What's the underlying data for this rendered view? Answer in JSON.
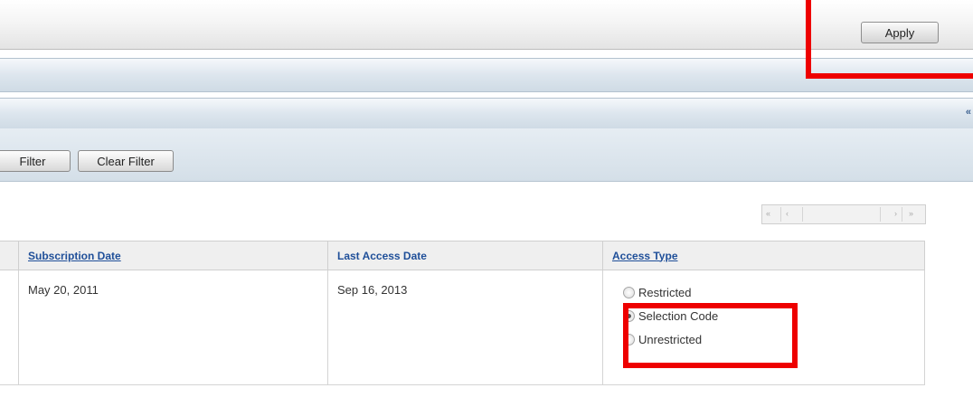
{
  "toolbar": {
    "apply_label": "Apply"
  },
  "panels": {
    "first": {
      "toggle_icon": "expand-double-chevron-icon",
      "toggle_glyph": "»"
    },
    "second": {
      "toggle_icon": "collapse-double-chevron-icon",
      "toggle_glyph": "«"
    }
  },
  "filter_bar": {
    "filter_label": "Filter",
    "clear_filter_label": "Clear Filter"
  },
  "pager": {
    "first": "«",
    "prev": "‹",
    "next": "›",
    "last": "»"
  },
  "table": {
    "headers": [
      "Subscription Date",
      "Last Access Date",
      "Access Type"
    ],
    "rows": [
      {
        "subscription_date": "May 20, 2011",
        "last_access_date": "Sep 16, 2013",
        "access_options": [
          {
            "label": "Restricted",
            "checked": false
          },
          {
            "label": "Selection Code",
            "checked": true
          },
          {
            "label": "Unrestricted",
            "checked": false
          }
        ]
      }
    ]
  },
  "colors": {
    "highlight": "#ee0000",
    "link": "#1f4f99",
    "bar": "#dde6ee"
  }
}
